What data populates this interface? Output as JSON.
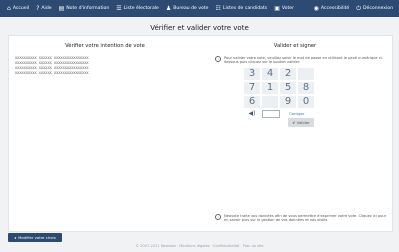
{
  "nav": {
    "accueil": "Accueil",
    "aide": "Aide",
    "note": "Note d'information",
    "liste": "Liste électorale",
    "bureau": "Bureau de vote",
    "candidats": "Listes de candidats",
    "voter": "Voter",
    "accessibilite": "Accessibilité",
    "deconnexion": "Déconnexion"
  },
  "page": {
    "title": "Vérifier et valider votre vote"
  },
  "left": {
    "title": "Vérifier votre intention de vote",
    "lines": [
      "XXXXXXXXXX XXXXXX XXXXXXXXXXXXXXXX",
      "XXXXXXXXXX XXXXXX XXXXXXXXXXXXXXXX",
      "XXXXXXXXXX XXXXXX XXXXXXXXXXXXXXXX",
      "XXXXXXXXXX XXXXXX XXXXXXXXXXXXXXXX"
    ]
  },
  "right": {
    "title": "Valider et signer",
    "instructions": "Pour valider votre vote, veuillez saisir le mot de passe en utilisant le pavé numérique ci-dessous puis cliquez sur le bouton valider.",
    "keys": [
      "3",
      "4",
      "2",
      "7",
      "1",
      "5",
      "8",
      "6",
      "9",
      "0"
    ],
    "corriger": "Corriger",
    "valider": "Valider",
    "notice": "Neovote traite vos données afin de vous permettre d'exprimer votre vote. Cliquez ici pour en savoir plus sur la gestion de vos données et vos droits"
  },
  "modifier": "Modifier votre choix",
  "footer": "© 2007-2021 Neovote · Mentions légales · Confidentialité · Plan du site"
}
